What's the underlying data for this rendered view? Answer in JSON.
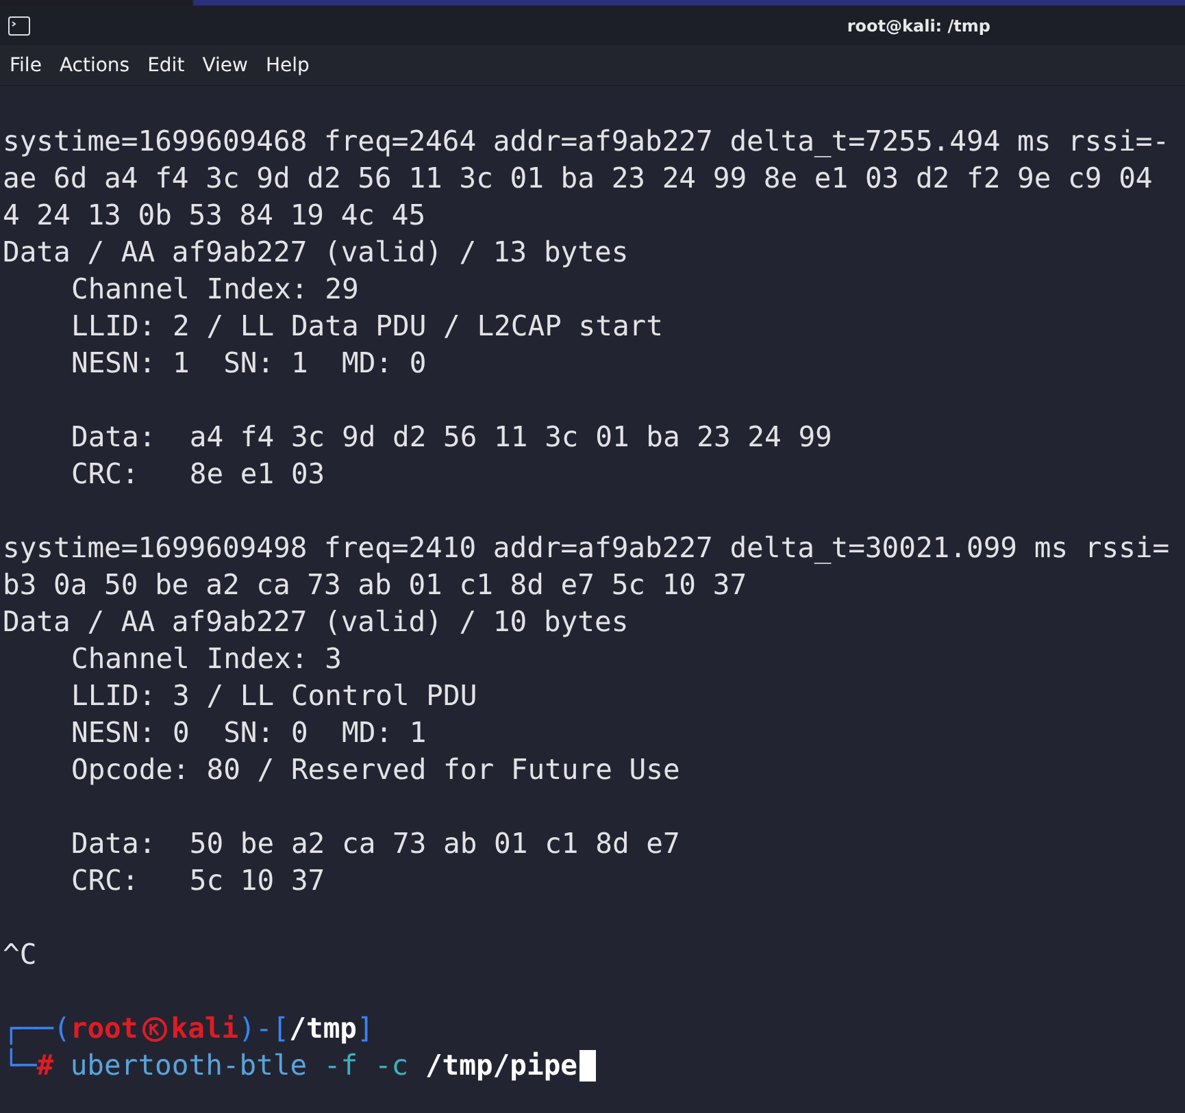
{
  "window": {
    "title": "root@kali: /tmp"
  },
  "menu": [
    "File",
    "Actions",
    "Edit",
    "View",
    "Help"
  ],
  "packets": [
    {
      "lines": [
        "systime=1699609468 freq=2464 addr=af9ab227 delta_t=7255.494 ms rssi=-",
        "ae 6d a4 f4 3c 9d d2 56 11 3c 01 ba 23 24 99 8e e1 03 d2 f2 9e c9 04",
        "4 24 13 0b 53 84 19 4c 45"
      ],
      "summary": "Data / AA af9ab227 (valid) / 13 bytes",
      "fields": [
        "Channel Index: 29",
        "LLID: 2 / LL Data PDU / L2CAP start",
        "NESN: 1  SN: 1  MD: 0"
      ],
      "payload": [
        "Data:  a4 f4 3c 9d d2 56 11 3c 01 ba 23 24 99",
        "CRC:   8e e1 03"
      ]
    },
    {
      "lines": [
        "systime=1699609498 freq=2410 addr=af9ab227 delta_t=30021.099 ms rssi=",
        "b3 0a 50 be a2 ca 73 ab 01 c1 8d e7 5c 10 37"
      ],
      "summary": "Data / AA af9ab227 (valid) / 10 bytes",
      "fields": [
        "Channel Index: 3",
        "LLID: 3 / LL Control PDU",
        "NESN: 0  SN: 0  MD: 1",
        "Opcode: 80 / Reserved for Future Use"
      ],
      "payload": [
        "Data:  50 be a2 ca 73 ab 01 c1 8d e7",
        "CRC:   5c 10 37"
      ]
    }
  ],
  "interrupt": "^C",
  "prompt": {
    "open": "┌──(",
    "user": "root",
    "host": "kali",
    "mid": ")-[",
    "cwd": "/tmp",
    "close": "]",
    "corner": "└─",
    "symbol": "#",
    "command": "ubertooth-btle",
    "args": "-f -c",
    "path": "/tmp/pipe"
  }
}
